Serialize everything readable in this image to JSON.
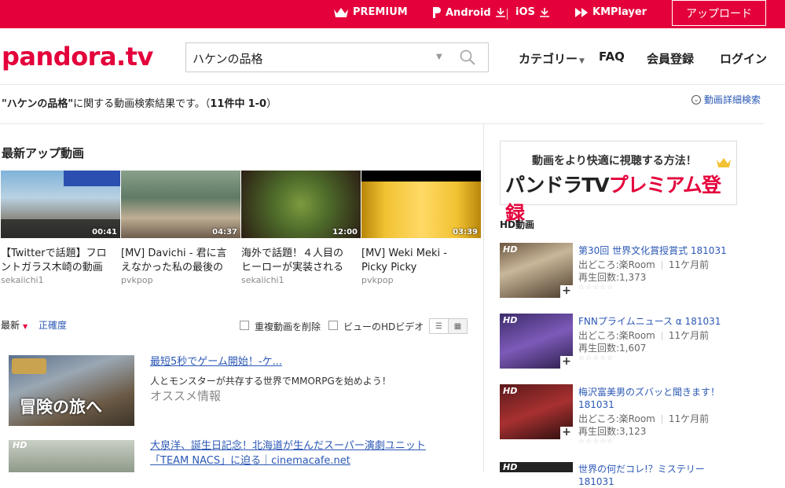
{
  "topbar": {
    "premium": "PREMIUM",
    "android": "Android",
    "ios": "iOS",
    "kmplayer": "KMPlayer",
    "upload": "アップロード"
  },
  "header": {
    "logo": "pandora.tv",
    "search_value": "ハケンの品格",
    "nav": [
      "カテゴリー",
      "FAQ",
      "会員登録",
      "ログイン"
    ]
  },
  "results": {
    "query": "\"ハケンの品格\"",
    "suffix": "に関する動画検索結果です。（",
    "count": "11件中",
    "range": "1-0",
    "close": "）",
    "detail_search": "動画詳細検索"
  },
  "latest": {
    "title": "最新アップ動画",
    "videos": [
      {
        "title": "【Twitterで話題】フロントガラス木崎の動画",
        "channel": "sekaiichi1",
        "duration": "00:41"
      },
      {
        "title": "[MV] Davichi - 君に言えなかった私の最後の",
        "channel": "pvkpop",
        "duration": "04:37"
      },
      {
        "title": "海外で話題！４人目のヒーローが実装される",
        "channel": "sekaiichi1",
        "duration": "12:00"
      },
      {
        "title": "[MV] Weki Meki - Picky Picky",
        "channel": "pvkpop",
        "duration": "03:39"
      }
    ]
  },
  "sortbar": {
    "latest": "最新",
    "accuracy": "正確度",
    "dedupe": "重複動画を削除",
    "hd_only": "ビューのHDビデオ"
  },
  "ads": [
    {
      "title": "最短5秒でゲーム開始！-ケ...",
      "desc": "人とモンスターが共存する世界でMMORPGを始めよう！",
      "sub": "オススメ情報",
      "thumb_text": "冒険の旅へ"
    },
    {
      "title": "大泉洋、誕生日記念！北海道が生んだスーパー演劇ユニット「TEAM NACS」に迫る｜cinemacafe.net",
      "badge": "HD"
    }
  ],
  "right": {
    "banner_line1": "動画をより快適に視聴する方法！",
    "banner_line2a": "パンドラTV",
    "banner_line2b": "プレミアム登録",
    "hd_title": "HD動画",
    "hd_videos": [
      {
        "title": "第30回 世界文化賞授賞式 181031",
        "source": "出どころ:楽Room",
        "age": "11ケ月前",
        "views": "再生回数:1,373"
      },
      {
        "title": "FNNプライムニュース α 181031",
        "source": "出どころ:楽Room",
        "age": "11ケ月前",
        "views": "再生回数:1,607"
      },
      {
        "title": "梅沢富美男のズバッと聞きます！181031",
        "source": "出どころ:楽Room",
        "age": "11ケ月前",
        "views": "再生回数:3,123"
      },
      {
        "title": "世界の何だコレ!？ミステリー 181031"
      }
    ],
    "badge": "HD",
    "stars": "☆☆☆☆☆"
  }
}
